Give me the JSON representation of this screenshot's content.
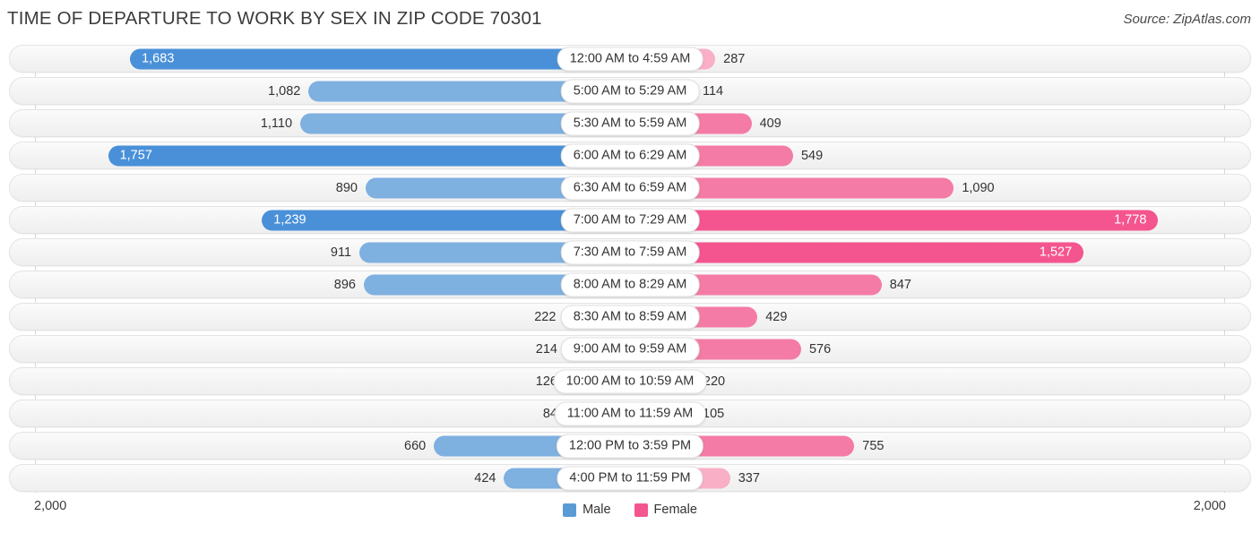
{
  "header": {
    "title": "TIME OF DEPARTURE TO WORK BY SEX IN ZIP CODE 70301",
    "source": "Source: ZipAtlas.com"
  },
  "axis": {
    "left_label": "2,000",
    "right_label": "2,000",
    "max": 2000
  },
  "legend": {
    "items": [
      {
        "label": "Male",
        "color": "#5b9bd5"
      },
      {
        "label": "Female",
        "color": "#f4558e"
      }
    ]
  },
  "colors": {
    "male_dark": "#4a90d9",
    "male_mid": "#7eb0e0",
    "male_light": "#afcbec",
    "female_dark": "#f4558e",
    "female_mid": "#f47ba6",
    "female_light": "#f9afc6",
    "row_bg": "#f4f4f4",
    "row_border": "#e3e3e3"
  },
  "chart_data": {
    "type": "bar",
    "title": "TIME OF DEPARTURE TO WORK BY SEX IN ZIP CODE 70301",
    "subtitle": "Source: ZipAtlas.com",
    "orientation": "horizontal-diverging",
    "xlabel": "",
    "ylabel": "",
    "xlim": [
      2000,
      2000
    ],
    "grid": false,
    "legend_position": "bottom-center",
    "categories": [
      "12:00 AM to 4:59 AM",
      "5:00 AM to 5:29 AM",
      "5:30 AM to 5:59 AM",
      "6:00 AM to 6:29 AM",
      "6:30 AM to 6:59 AM",
      "7:00 AM to 7:29 AM",
      "7:30 AM to 7:59 AM",
      "8:00 AM to 8:29 AM",
      "8:30 AM to 8:59 AM",
      "9:00 AM to 9:59 AM",
      "10:00 AM to 10:59 AM",
      "11:00 AM to 11:59 AM",
      "12:00 PM to 3:59 PM",
      "4:00 PM to 11:59 PM"
    ],
    "series": [
      {
        "name": "Male",
        "values": [
          1683,
          1082,
          1110,
          1757,
          890,
          1239,
          911,
          896,
          222,
          214,
          126,
          84,
          660,
          424
        ],
        "labels": [
          "1,683",
          "1,082",
          "1,110",
          "1,757",
          "890",
          "1,239",
          "911",
          "896",
          "222",
          "214",
          "126",
          "84",
          "660",
          "424"
        ]
      },
      {
        "name": "Female",
        "values": [
          287,
          114,
          409,
          549,
          1090,
          1778,
          1527,
          847,
          429,
          576,
          220,
          105,
          755,
          337
        ],
        "labels": [
          "287",
          "114",
          "409",
          "549",
          "1,090",
          "1,778",
          "1,527",
          "847",
          "429",
          "576",
          "220",
          "105",
          "755",
          "337"
        ]
      }
    ]
  },
  "rows": [
    {
      "label": "12:00 AM to 4:59 AM",
      "male": 1683,
      "male_label": "1,683",
      "male_inside": true,
      "female": 287,
      "female_label": "287",
      "female_inside": false
    },
    {
      "label": "5:00 AM to 5:29 AM",
      "male": 1082,
      "male_label": "1,082",
      "male_inside": false,
      "female": 114,
      "female_label": "114",
      "female_inside": false
    },
    {
      "label": "5:30 AM to 5:59 AM",
      "male": 1110,
      "male_label": "1,110",
      "male_inside": false,
      "female": 409,
      "female_label": "409",
      "female_inside": false
    },
    {
      "label": "6:00 AM to 6:29 AM",
      "male": 1757,
      "male_label": "1,757",
      "male_inside": true,
      "female": 549,
      "female_label": "549",
      "female_inside": false
    },
    {
      "label": "6:30 AM to 6:59 AM",
      "male": 890,
      "male_label": "890",
      "male_inside": false,
      "female": 1090,
      "female_label": "1,090",
      "female_inside": false
    },
    {
      "label": "7:00 AM to 7:29 AM",
      "male": 1239,
      "male_label": "1,239",
      "male_inside": true,
      "female": 1778,
      "female_label": "1,778",
      "female_inside": true
    },
    {
      "label": "7:30 AM to 7:59 AM",
      "male": 911,
      "male_label": "911",
      "male_inside": false,
      "female": 1527,
      "female_label": "1,527",
      "female_inside": true
    },
    {
      "label": "8:00 AM to 8:29 AM",
      "male": 896,
      "male_label": "896",
      "male_inside": false,
      "female": 847,
      "female_label": "847",
      "female_inside": false
    },
    {
      "label": "8:30 AM to 8:59 AM",
      "male": 222,
      "male_label": "222",
      "male_inside": false,
      "female": 429,
      "female_label": "429",
      "female_inside": false
    },
    {
      "label": "9:00 AM to 9:59 AM",
      "male": 214,
      "male_label": "214",
      "male_inside": false,
      "female": 576,
      "female_label": "576",
      "female_inside": false
    },
    {
      "label": "10:00 AM to 10:59 AM",
      "male": 126,
      "male_label": "126",
      "male_inside": false,
      "female": 220,
      "female_label": "220",
      "female_inside": false
    },
    {
      "label": "11:00 AM to 11:59 AM",
      "male": 84,
      "male_label": "84",
      "male_inside": false,
      "female": 105,
      "female_label": "105",
      "female_inside": false
    },
    {
      "label": "12:00 PM to 3:59 PM",
      "male": 660,
      "male_label": "660",
      "male_inside": false,
      "female": 755,
      "female_label": "755",
      "female_inside": false
    },
    {
      "label": "4:00 PM to 11:59 PM",
      "male": 424,
      "male_label": "424",
      "male_inside": false,
      "female": 337,
      "female_label": "337",
      "female_inside": false
    }
  ]
}
